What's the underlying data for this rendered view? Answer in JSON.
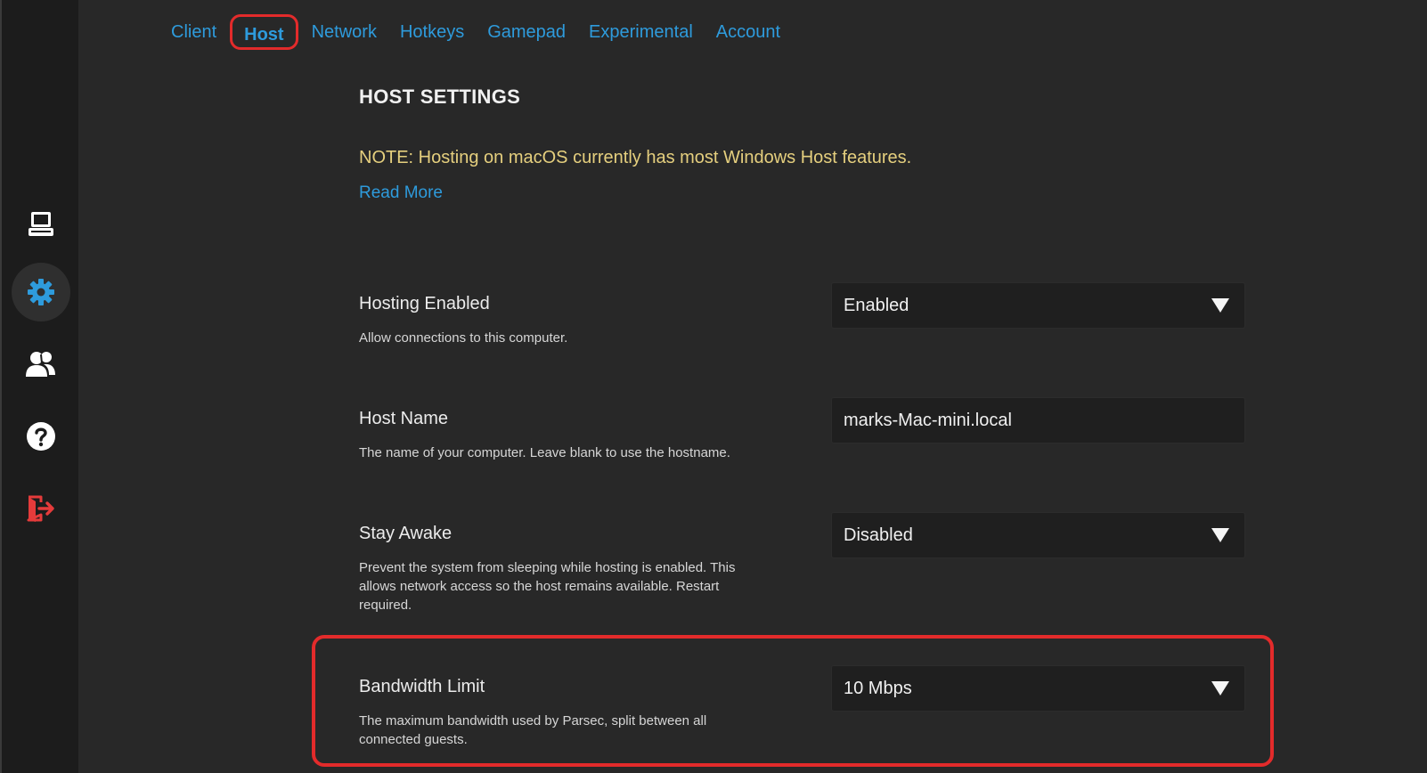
{
  "sidebar": {
    "items": [
      {
        "name": "computers",
        "icon": "computer-icon"
      },
      {
        "name": "settings",
        "icon": "gear-icon",
        "active": true
      },
      {
        "name": "friends",
        "icon": "people-icon"
      },
      {
        "name": "help",
        "icon": "help-icon"
      },
      {
        "name": "logout",
        "icon": "logout-icon"
      }
    ]
  },
  "tabs": [
    {
      "label": "Client"
    },
    {
      "label": "Host",
      "active": true
    },
    {
      "label": "Network"
    },
    {
      "label": "Hotkeys"
    },
    {
      "label": "Gamepad"
    },
    {
      "label": "Experimental"
    },
    {
      "label": "Account"
    }
  ],
  "main": {
    "heading": "HOST SETTINGS",
    "note": "NOTE: Hosting on macOS currently has most Windows Host features.",
    "read_more": "Read More",
    "settings": {
      "hosting_enabled": {
        "title": "Hosting Enabled",
        "description": "Allow connections to this computer.",
        "value": "Enabled"
      },
      "host_name": {
        "title": "Host Name",
        "description": "The name of your computer. Leave blank to use the hostname.",
        "value": "marks-Mac-mini.local"
      },
      "stay_awake": {
        "title": "Stay Awake",
        "description": "Prevent the system from sleeping while hosting is enabled. This allows network access so the host remains available. Restart required.",
        "value": "Disabled"
      },
      "bandwidth_limit": {
        "title": "Bandwidth Limit",
        "description": "The maximum bandwidth used by Parsec, split between all connected guests.",
        "value": "10 Mbps"
      }
    }
  },
  "colors": {
    "accent": "#2e9bdc",
    "note": "#e5cf7e",
    "highlight": "#e32b2b",
    "logout": "#e53b3b",
    "background": "#282828",
    "sidebar": "#1c1c1c"
  }
}
